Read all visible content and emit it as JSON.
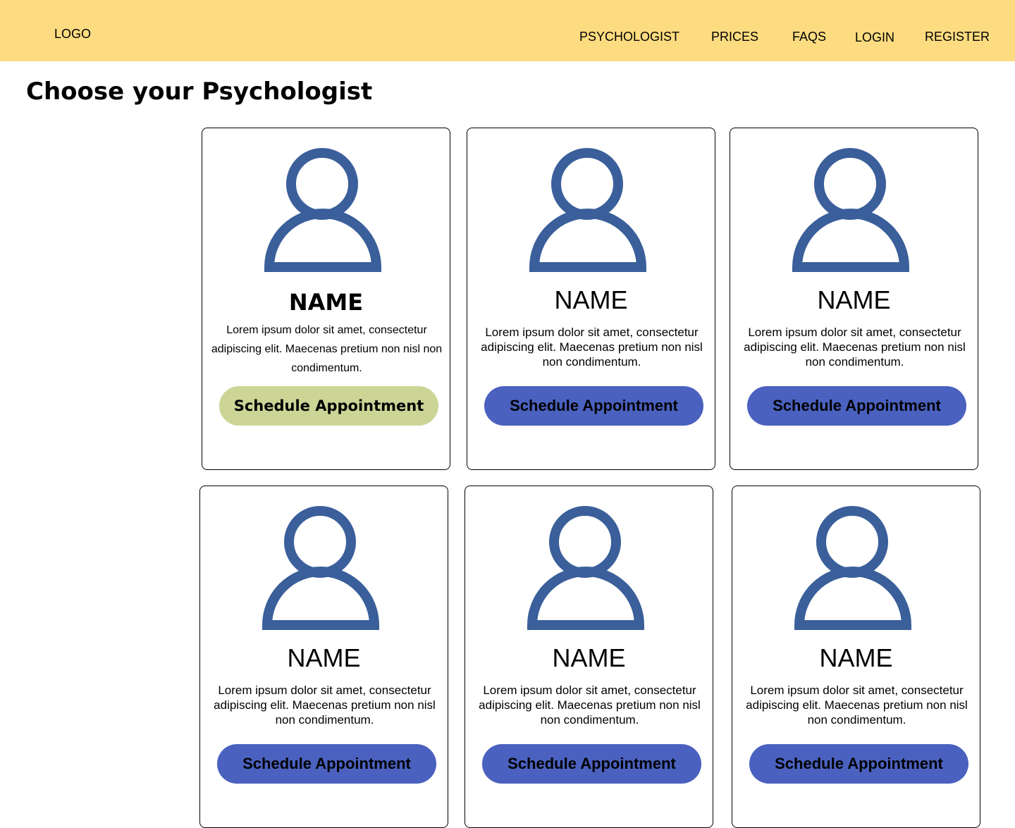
{
  "header": {
    "logo": "LOGO",
    "nav": {
      "psychologist": "PSYCHOLOGIST",
      "prices": "PRICES",
      "faqs": "FAQS",
      "login": "LOGIN",
      "register": "REGISTER"
    },
    "background_color": "#fddc81"
  },
  "page_title": "Choose your Psychologist",
  "cards": [
    {
      "name": "NAME",
      "description": "Lorem ipsum dolor sit amet, consectetur adipiscing elit. Maecenas pretium non nisl non condimentum.",
      "button": "Schedule Appointment"
    },
    {
      "name": "NAME",
      "description": "Lorem ipsum dolor sit amet, consectetur adipiscing elit. Maecenas pretium non nisl non condimentum.",
      "button": "Schedule Appointment"
    },
    {
      "name": "NAME",
      "description": "Lorem ipsum dolor sit amet, consectetur adipiscing elit. Maecenas pretium non nisl non condimentum.",
      "button": "Schedule Appointment"
    },
    {
      "name": "NAME",
      "description": "Lorem ipsum dolor sit amet, consectetur adipiscing elit. Maecenas pretium non nisl non condimentum.",
      "button": "Schedule Appointment"
    },
    {
      "name": "NAME",
      "description": "Lorem ipsum dolor sit amet, consectetur adipiscing elit. Maecenas pretium non nisl non condimentum.",
      "button": "Schedule Appointment"
    },
    {
      "name": "NAME",
      "description": "Lorem ipsum dolor sit amet, consectetur adipiscing elit. Maecenas pretium non nisl non condimentum.",
      "button": "Schedule Appointment"
    }
  ],
  "icons": {
    "avatar": "user-avatar-icon"
  },
  "colors": {
    "avatar": "#3a5f9a",
    "button_primary": "#4a61bf",
    "button_active": "#ccd596"
  }
}
